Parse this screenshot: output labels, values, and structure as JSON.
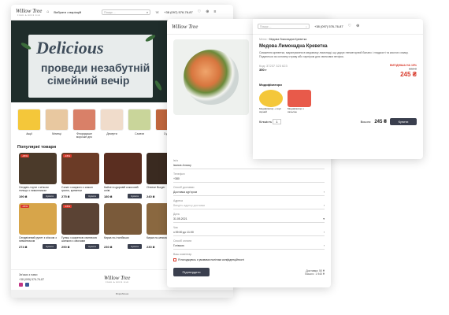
{
  "win1": {
    "logo": "Willow Tree",
    "logo_sub": "FOOD & BEER BAR",
    "header_link": "Вибрати з варіацій",
    "search_ph": "Пошук ...",
    "phone": "+38 (097) 576-76-87",
    "hero_title": "Delicious",
    "hero_line1": "проведи незабутній",
    "hero_line2": "сімейний вечір",
    "categories": [
      {
        "label": "Акції"
      },
      {
        "label": "Млинці"
      },
      {
        "label": "Флоридське морське дно"
      },
      {
        "label": "Десерти"
      },
      {
        "label": "Салати"
      },
      {
        "label": "Супи"
      },
      {
        "label": "Ф'ю"
      }
    ],
    "section_title": "Популярні товари",
    "products": [
      {
        "name": "Сендвіч-торти з м'ясом тельця з лимонником",
        "weight": "200 г",
        "price": "190 ₴",
        "badge": "-15%",
        "buy": "Купити"
      },
      {
        "name": "Салат з жаркого з кажон грилю, креветки",
        "weight": "290 г",
        "price": "275 ₴",
        "badge": "-15%",
        "buy": "Купити"
      },
      {
        "name": "Кайсе в цукровій кокосовій оліві",
        "weight": "200 г",
        "price": "180 ₴",
        "badge": "",
        "buy": "Купити"
      },
      {
        "name": "Cheese Burger",
        "weight": "",
        "price": "240 ₴",
        "badge": "",
        "buy": "Купити"
      },
      {
        "name": "Сендвічевий рулет з м'ясом з лимонником",
        "weight": "250 г",
        "price": "274 ₴",
        "badge": "-15%",
        "buy": "Купити"
      },
      {
        "name": "Гуляш з жареною свинячою шинкою з овочами",
        "weight": "250 г",
        "price": "290 ₴",
        "badge": "-15%",
        "buy": "Купити"
      },
      {
        "name": "Кирка по-італійськи",
        "weight": "",
        "price": "230 ₴",
        "badge": "",
        "buy": "Купити"
      },
      {
        "name": "Кирка по-мексиканськи",
        "weight": "",
        "price": "230 ₴",
        "badge": "",
        "buy": "Купити"
      }
    ],
    "footer_contacts": "Зв'язки з нами",
    "footer_phone": "+38 (095) 576-76-87",
    "footer_link": "Про нас",
    "bottom_credit": "Розроблено"
  },
  "win3": {
    "search_ph": "Пошук ...",
    "header_link": "Змінити кількість",
    "phone": "+38 (097) 576-76-87",
    "breadcrumb": [
      "Меню",
      "Медова Лимонадна Креветка"
    ],
    "title": "Медова Лимонадна Креветка",
    "description": "Смаження креветки, маринування в медовому лимонаді, що дарує неповторний баланс і гладкості та кислого смаку. Подаються як основну страву або гарніром для святкових вечірок.",
    "code": "Код: 37237 323 623",
    "weight": "350 г",
    "badge": "ВИГІДНІША НА 15%",
    "old_price": "300 ₴",
    "price": "245 ₴",
    "mods_title": "Модифікатори",
    "mods": [
      {
        "name": "Модифікатор + соус сирний"
      },
      {
        "name": "Модифікатор з сальсою"
      }
    ],
    "qty_label": "Кількість",
    "qty": "1",
    "total_label": "Всього:",
    "total": "245 ₴",
    "buy": "Купити"
  },
  "win2": {
    "logo": "Willow Tree",
    "fields": [
      {
        "label": "Ім'я",
        "value": "Іванов Аляску"
      },
      {
        "label": "Телефон",
        "value": "+380"
      },
      {
        "label": "Спосіб доставки",
        "value": "Доставка кур'єром"
      },
      {
        "label": "Адреса",
        "value": "Введіть адресу доставки"
      },
      {
        "label": "Дата",
        "value": "31.05.2021"
      },
      {
        "label": "Час",
        "value": "з 09:00 до 11:00"
      },
      {
        "label": "Спосіб оплати",
        "value": "Готівкою"
      }
    ],
    "comment_label": "Ваш коментар",
    "agree": "Я погоджуюсь з умовами політики конфіденційності",
    "submit": "Підтвердити",
    "delivery": "Доставка: 50 ₴",
    "sum": "Всього: 1 940 ₴"
  },
  "colors": {
    "dark": "#3a3f4e",
    "red": "#d83b2c",
    "hero": "#1f2d2b"
  }
}
